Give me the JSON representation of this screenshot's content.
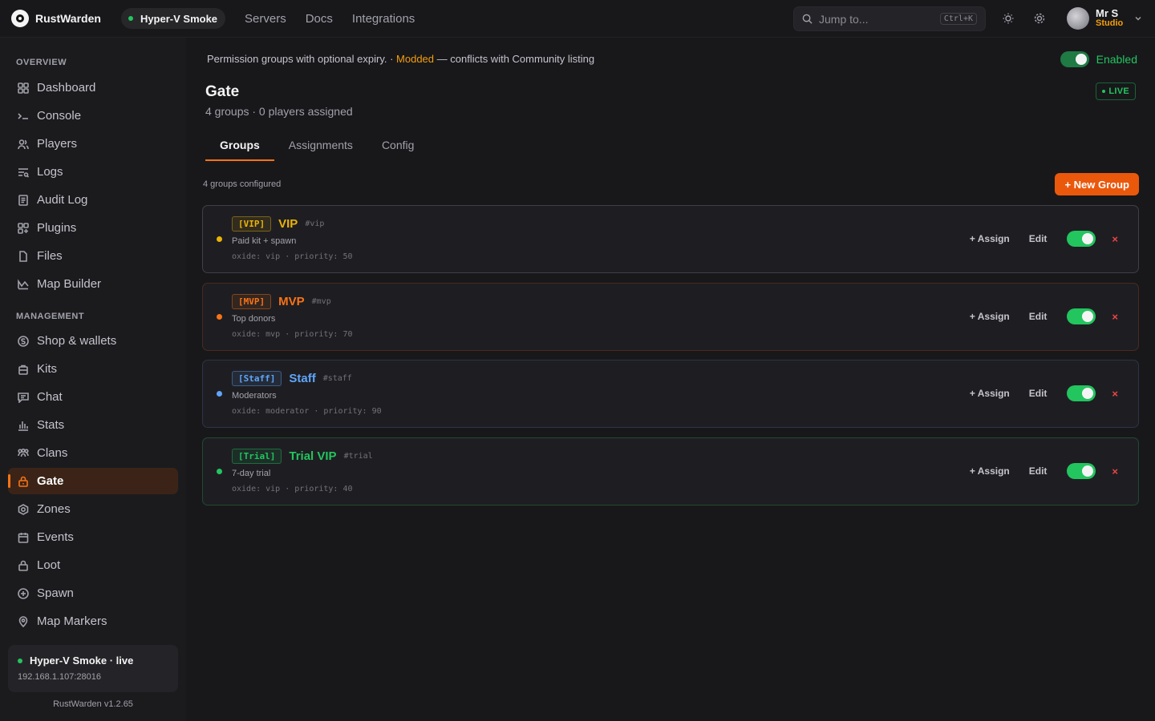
{
  "app": {
    "name": "RustWarden",
    "version": "RustWarden v1.2.65"
  },
  "topbar": {
    "server_pill": "Hyper-V Smoke",
    "nav": [
      "Servers",
      "Docs",
      "Integrations"
    ],
    "search_placeholder": "Jump to...",
    "search_shortcut": "Ctrl+K",
    "user_name": "Mr S",
    "user_role": "Studio"
  },
  "sidebar": {
    "overview_title": "OVERVIEW",
    "management_title": "MANAGEMENT",
    "overview_items": [
      {
        "label": "Dashboard",
        "icon": "grid-icon"
      },
      {
        "label": "Console",
        "icon": "terminal-icon"
      },
      {
        "label": "Players",
        "icon": "users-icon"
      },
      {
        "label": "Logs",
        "icon": "logs-icon"
      },
      {
        "label": "Audit Log",
        "icon": "document-icon"
      },
      {
        "label": "Plugins",
        "icon": "puzzle-icon"
      },
      {
        "label": "Files",
        "icon": "file-icon"
      },
      {
        "label": "Map Builder",
        "icon": "map-icon"
      }
    ],
    "management_items": [
      {
        "label": "Shop & wallets",
        "icon": "coin-icon"
      },
      {
        "label": "Kits",
        "icon": "bag-icon"
      },
      {
        "label": "Chat",
        "icon": "chat-icon"
      },
      {
        "label": "Stats",
        "icon": "bar-chart-icon"
      },
      {
        "label": "Clans",
        "icon": "group-icon"
      },
      {
        "label": "Gate",
        "icon": "lock-icon",
        "active": true
      },
      {
        "label": "Zones",
        "icon": "zone-icon"
      },
      {
        "label": "Events",
        "icon": "calendar-icon"
      },
      {
        "label": "Loot",
        "icon": "lock-icon"
      },
      {
        "label": "Spawn",
        "icon": "plus-circle-icon"
      },
      {
        "label": "Map Markers",
        "icon": "pin-icon"
      }
    ],
    "status_title": "Hyper-V Smoke · live",
    "status_ip": "192.168.1.107:28016"
  },
  "main": {
    "notice_prefix": "Permission groups with optional expiry. · ",
    "notice_modded": "Modded",
    "notice_suffix": " — conflicts with Community listing",
    "enabled_label": "Enabled",
    "title": "Gate",
    "live_badge": "LIVE",
    "subtitle": "4 groups · 0 players assigned",
    "tabs": [
      "Groups",
      "Assignments",
      "Config"
    ],
    "active_tab": "Groups",
    "configured_label": "4 groups configured",
    "new_group_label": "+ New Group",
    "assign_label": "+ Assign",
    "edit_label": "Edit",
    "delete_label": "×"
  },
  "groups": [
    {
      "tag": "[VIP]",
      "name": "VIP",
      "slug": "#vip",
      "desc": "Paid kit + spawn",
      "meta": "oxide: vip · priority: 50",
      "color": "#eab308",
      "border": "#3f3f46",
      "enabled": true
    },
    {
      "tag": "[MVP]",
      "name": "MVP",
      "slug": "#mvp",
      "desc": "Top donors",
      "meta": "oxide: mvp · priority: 70",
      "color": "#f97316",
      "border": "#4a2a20",
      "enabled": true
    },
    {
      "tag": "[Staff]",
      "name": "Staff",
      "slug": "#staff",
      "desc": "Moderators",
      "meta": "oxide: moderator · priority: 90",
      "color": "#60a5fa",
      "border": "#2c3446",
      "enabled": true
    },
    {
      "tag": "[Trial]",
      "name": "Trial VIP",
      "slug": "#trial",
      "desc": "7-day trial",
      "meta": "oxide: vip · priority: 40",
      "color": "#22c55e",
      "border": "#1f4a30",
      "enabled": true
    }
  ],
  "colors": {
    "accent": "#f97316",
    "success": "#22c55e",
    "warning": "#f59e0b",
    "danger": "#ef4444"
  }
}
